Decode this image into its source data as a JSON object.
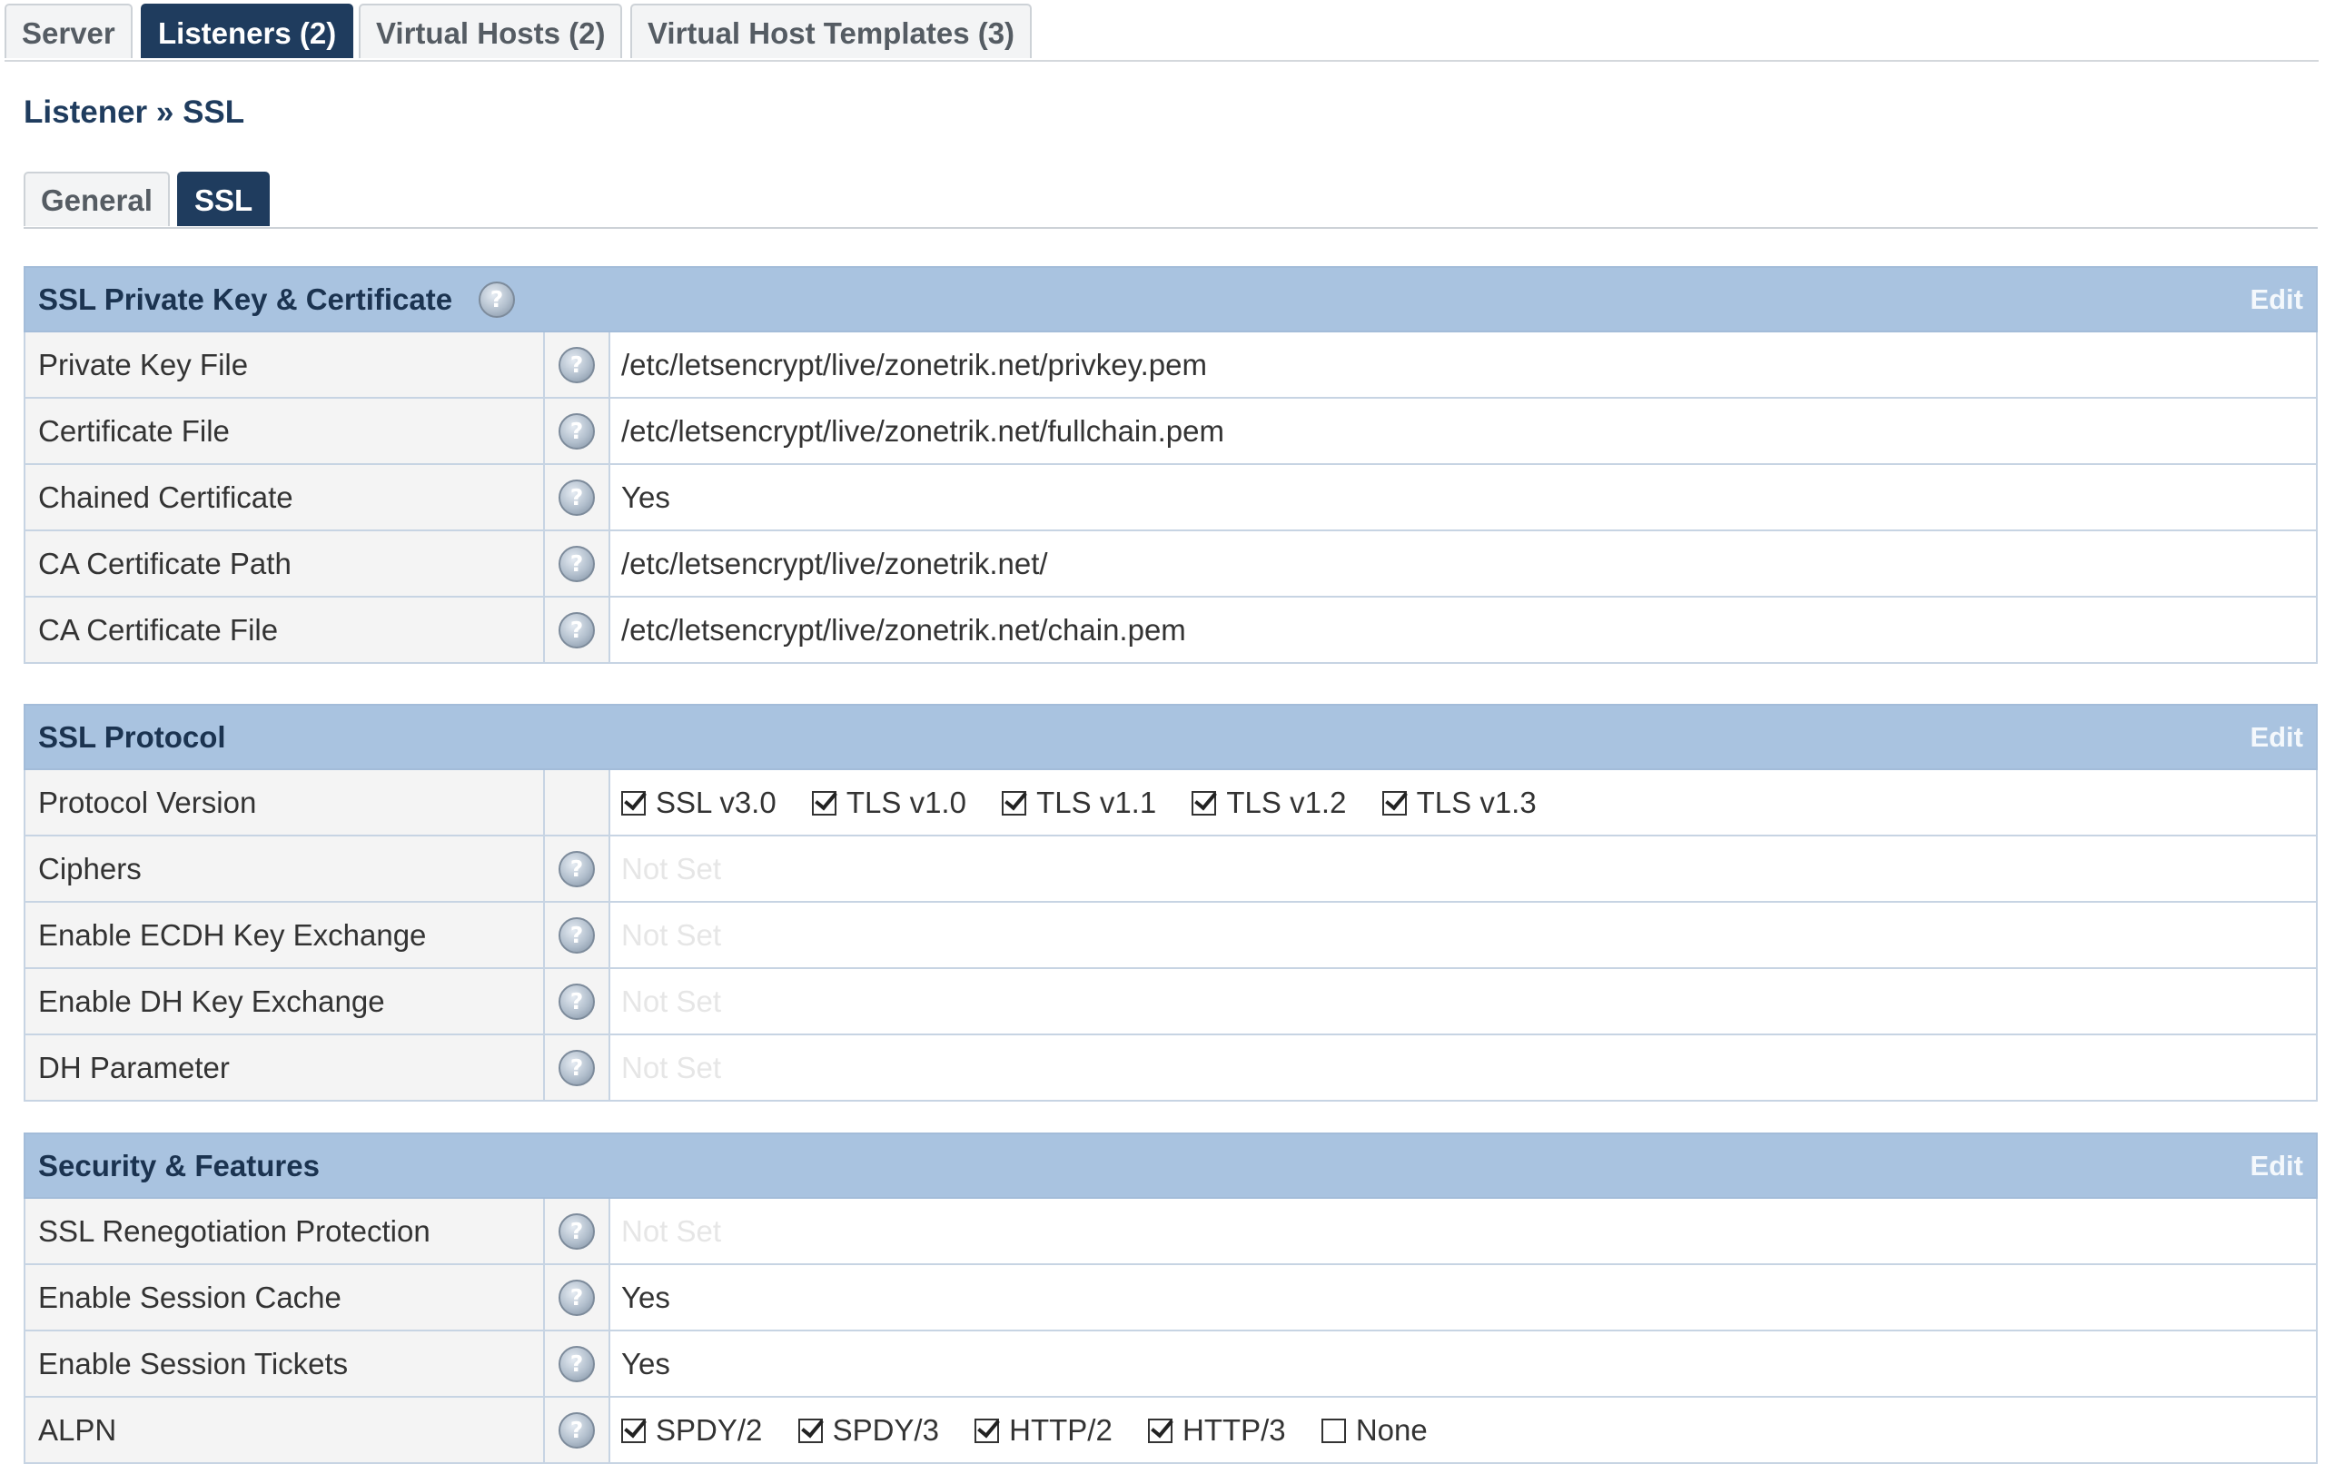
{
  "top_tabs": [
    {
      "label": "Server"
    },
    {
      "label": "Listeners (2)"
    },
    {
      "label": "Virtual Hosts (2)"
    },
    {
      "label": "Virtual Host Templates (3)"
    }
  ],
  "active_top_tab": "Listeners (2)",
  "breadcrumb": "Listener » SSL",
  "sub_tabs": [
    {
      "label": "General"
    },
    {
      "label": "SSL"
    }
  ],
  "active_sub_tab": "SSL",
  "help_glyph": "?",
  "sections": [
    {
      "title": "SSL Private Key & Certificate",
      "edit_label": "Edit",
      "rows": [
        {
          "label": "Private Key File",
          "value": "/etc/letsencrypt/live/zonetrik.net/privkey.pem"
        },
        {
          "label": "Certificate File",
          "value": "/etc/letsencrypt/live/zonetrik.net/fullchain.pem"
        },
        {
          "label": "Chained Certificate",
          "value": "Yes"
        },
        {
          "label": "CA Certificate Path",
          "value": "/etc/letsencrypt/live/zonetrik.net/"
        },
        {
          "label": "CA Certificate File",
          "value": "/etc/letsencrypt/live/zonetrik.net/chain.pem"
        }
      ]
    },
    {
      "title": "SSL Protocol",
      "edit_label": "Edit",
      "rows": [
        {
          "label": "Protocol Version",
          "options": [
            {
              "label": "SSL v3.0",
              "checked": true
            },
            {
              "label": "TLS v1.0",
              "checked": true
            },
            {
              "label": "TLS v1.1",
              "checked": true
            },
            {
              "label": "TLS v1.2",
              "checked": true
            },
            {
              "label": "TLS v1.3",
              "checked": true
            }
          ]
        },
        {
          "label": "Ciphers",
          "value": "Not Set"
        },
        {
          "label": "Enable ECDH Key Exchange",
          "value": "Not Set"
        },
        {
          "label": "Enable DH Key Exchange",
          "value": "Not Set"
        },
        {
          "label": "DH Parameter",
          "value": "Not Set"
        }
      ]
    },
    {
      "title": "Security & Features",
      "edit_label": "Edit",
      "rows": [
        {
          "label": "SSL Renegotiation Protection",
          "value": "Not Set"
        },
        {
          "label": "Enable Session Cache",
          "value": "Yes"
        },
        {
          "label": "Enable Session Tickets",
          "value": "Yes"
        },
        {
          "label": "ALPN",
          "options": [
            {
              "label": "SPDY/2",
              "checked": true
            },
            {
              "label": "SPDY/3",
              "checked": true
            },
            {
              "label": "HTTP/2",
              "checked": true
            },
            {
              "label": "HTTP/3",
              "checked": true
            },
            {
              "label": "None",
              "checked": false
            }
          ]
        }
      ]
    }
  ],
  "colors": {
    "nav_active": "#1f3c5e",
    "section_header": "#a9c3e0",
    "not_set_text": "#e6e6e6"
  }
}
